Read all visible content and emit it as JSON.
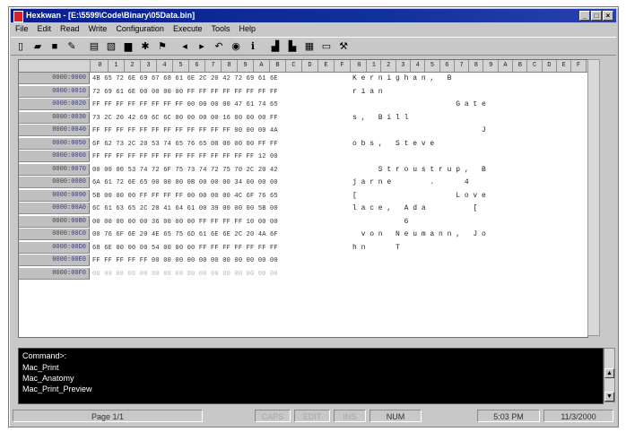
{
  "window": {
    "title": "Hexkwan - [E:\\5599\\Code\\Binary\\05Data.bin]",
    "buttons": [
      "_",
      "□",
      "×"
    ]
  },
  "menu": [
    "File",
    "Edit",
    "Read",
    "Write",
    "Configuration",
    "Execute",
    "Tools",
    "Help"
  ],
  "toolbar": [
    {
      "icon": "new-file-icon",
      "glyph": "▯"
    },
    {
      "icon": "open-folder-icon",
      "glyph": "▰"
    },
    {
      "icon": "save-icon",
      "glyph": "■"
    },
    {
      "icon": "pencil-icon",
      "glyph": "✎"
    },
    {
      "icon": "print-icon",
      "glyph": "▤"
    },
    {
      "icon": "print-preview-icon",
      "glyph": "▧"
    },
    {
      "icon": "book-icon",
      "glyph": "▆"
    },
    {
      "icon": "plugin-icon",
      "glyph": "✱"
    },
    {
      "icon": "flag-icon",
      "glyph": "⚑"
    },
    {
      "icon": "arrow-left-icon",
      "glyph": "◂"
    },
    {
      "icon": "arrow-right-icon",
      "glyph": "▸"
    },
    {
      "icon": "undo-icon",
      "glyph": "↶"
    },
    {
      "icon": "binoculars-icon",
      "glyph": "◉"
    },
    {
      "icon": "info-icon",
      "glyph": "ℹ"
    },
    {
      "icon": "chart-bar-icon",
      "glyph": "▟"
    },
    {
      "icon": "chart-alt-icon",
      "glyph": "▙"
    },
    {
      "icon": "table-icon",
      "glyph": "▦"
    },
    {
      "icon": "monitor-icon",
      "glyph": "▭"
    },
    {
      "icon": "tools-icon",
      "glyph": "⚒"
    }
  ],
  "hex_header": [
    "0",
    "1",
    "2",
    "3",
    "4",
    "5",
    "6",
    "7",
    "8",
    "9",
    "A",
    "B",
    "C",
    "D",
    "E",
    "F"
  ],
  "rows": [
    {
      "addr": "0000:0000",
      "hex": "4B 65 72 6E 69 67 68 61 6E 2C 20 42 72 69 61 6E",
      "ascii": "K e r n i g h a n ,   B",
      "faint": false
    },
    {
      "addr": "0000:0010",
      "hex": "72 69 61 6E 00 00 00 00 FF FF FF FF FF FF FF FF",
      "ascii": "r i a n",
      "faint": false
    },
    {
      "addr": "0000:0020",
      "hex": "FF FF FF FF FF FF FF FF 00 00 00 00 47 61 74 65",
      "ascii": "                        G a t e",
      "faint": false
    },
    {
      "addr": "0000:0030",
      "hex": "73 2C 20 42 69 6C 6C 00 00 00 00 16 00 00 00 FF",
      "ascii": "s ,   B i l l",
      "faint": false
    },
    {
      "addr": "0000:0040",
      "hex": "FF FF FF FF FF FF FF FF FF FF FF FF 00 00 00 4A",
      "ascii": "                              J",
      "faint": false
    },
    {
      "addr": "0000:0050",
      "hex": "6F 62 73 2C 20 53 74 65 76 65 00 00 00 00 FF FF",
      "ascii": "o b s ,   S t e v e",
      "faint": false
    },
    {
      "addr": "0000:0060",
      "hex": "FF FF FF FF FF FF FF FF FF FF FF FF FF FF 12 00",
      "ascii": "",
      "faint": false
    },
    {
      "addr": "0000:0070",
      "hex": "00 00 00 53 74 72 6F 75 73 74 72 75 70 2C 20 42",
      "ascii": "      S t r o u s t r u p ,   B",
      "faint": false
    },
    {
      "addr": "0000:0080",
      "hex": "6A 61 72 6E 65 00 00 00 0B 00 00 00 34 00 00 00",
      "ascii": "j a r n e         .       4",
      "faint": false
    },
    {
      "addr": "0000:0090",
      "hex": "5B 00 00 00 FF FF FF FF 00 00 00 00 4C 6F 76 65",
      "ascii": "[                       L o v e",
      "faint": false
    },
    {
      "addr": "0000:00A0",
      "hex": "6C 61 63 65 2C 20 41 64 61 00 39 00 00 00 5B 00",
      "ascii": "l a c e ,   A d a           [",
      "faint": false
    },
    {
      "addr": "0000:00B0",
      "hex": "00 00 00 00 00 36 00 00 00 FF FF FF FF 10 00 00",
      "ascii": "            6",
      "faint": false
    },
    {
      "addr": "0000:00C0",
      "hex": "00 76 6F 6E 20 4E 65 75 6D 61 6E 6E 2C 20 4A 6F",
      "ascii": "  v o n   N e u m a n n ,   J o",
      "faint": false
    },
    {
      "addr": "0000:00D0",
      "hex": "68 6E 00 00 00 54 00 00 00 FF FF FF FF FF FF FF",
      "ascii": "h n       T",
      "faint": false
    },
    {
      "addr": "0000:00E0",
      "hex": "FF FF FF FF FF 00 00 00 00 00 00 00 00 00 00 00",
      "ascii": "",
      "faint": false
    },
    {
      "addr": "0000:00F0",
      "hex": "00 00 00 00 00 00 00 00 00 00 00 00 00 00 00 00",
      "ascii": "",
      "faint": true
    }
  ],
  "command": {
    "lines": [
      "Command>:",
      "Mac_Print",
      "Mac_Anatomy",
      "Mac_Print_Preview"
    ]
  },
  "status": {
    "page": "Page 1/1",
    "caps": "CAPS",
    "edit": "EDIT",
    "ins": "INS",
    "num": "NUM",
    "time": "5:03 PM",
    "date": "11/3/2000"
  }
}
